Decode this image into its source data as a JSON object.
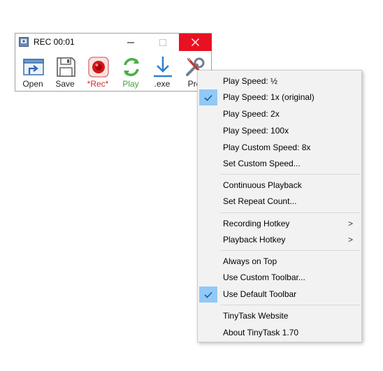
{
  "window": {
    "title": "REC 00:01",
    "controls": {
      "minimize": "—",
      "maximize": "☐",
      "close": "✕"
    }
  },
  "toolbar": {
    "buttons": [
      {
        "label": "Open",
        "icon": "open-icon"
      },
      {
        "label": "Save",
        "icon": "save-icon"
      },
      {
        "label": "*Rec*",
        "icon": "record-icon",
        "color": "#d12b2b"
      },
      {
        "label": "Play",
        "icon": "play-icon",
        "color": "#3aa63a"
      },
      {
        "label": ".exe",
        "icon": "compile-exe-icon"
      },
      {
        "label": "Pre",
        "icon": "prefs-icon"
      }
    ]
  },
  "menu": {
    "items": [
      {
        "label": "Play Speed:  ½",
        "checked": false
      },
      {
        "label": "Play Speed:  1x (original)",
        "checked": true
      },
      {
        "label": "Play Speed:  2x",
        "checked": false
      },
      {
        "label": "Play Speed:  100x",
        "checked": false
      },
      {
        "label": "Play Custom Speed:  8x",
        "checked": false
      },
      {
        "label": "Set Custom Speed...",
        "checked": false
      },
      {
        "label": "Continuous Playback",
        "checked": false
      },
      {
        "label": "Set Repeat Count...",
        "checked": false
      },
      {
        "label": "Recording Hotkey",
        "submenu": ">"
      },
      {
        "label": "Playback Hotkey",
        "submenu": ">"
      },
      {
        "label": "Always on Top",
        "checked": false
      },
      {
        "label": "Use Custom Toolbar...",
        "checked": false
      },
      {
        "label": "Use Default Toolbar",
        "checked": true
      },
      {
        "label": "TinyTask Website",
        "checked": false
      },
      {
        "label": "About TinyTask 1.70",
        "checked": false
      }
    ]
  },
  "colors": {
    "close_bg": "#e81123",
    "check_bg": "#91c9f7",
    "menu_bg": "#f2f2f2"
  }
}
